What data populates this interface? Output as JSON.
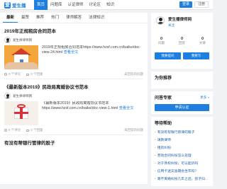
{
  "brand": {
    "name": "爱生播",
    "accent": "#1e7fe0"
  },
  "nav": [
    "首页",
    "问题库",
    "认证律师",
    "讨论区",
    "知识"
  ],
  "top_buttons": {
    "login": "登录",
    "register": "注册"
  },
  "tabs": [
    "最新",
    "最赞",
    "推荐",
    "热门",
    "律师解答",
    "法律知识"
  ],
  "cards": [
    {
      "title": "2019年正规租房合同范本",
      "author": "爱生律律师网",
      "excerpt": "2019年正规租房合同范本https://www.hzsf.com.cn/baike/doc-view-24.html",
      "more": "查看全文",
      "likes": "0 个评论",
      "comments": "0 个回复",
      "time": "未回答的问题",
      "thumb": "house"
    },
    {
      "title": "《最新版本2019》民政局离婚协议书范本",
      "author": "爱生律律师网",
      "excerpt": "《最新版本2019》民政局离婚协议书范本https://www.hzsf.com.cn/baike/doc-view-1.html",
      "more": "查看全文",
      "likes": "0 个评论",
      "comments": "0 个回复",
      "time": "未回答的问题",
      "thumb": "ribbon"
    },
    {
      "title": "有没有帮银行管律的股子",
      "author": "",
      "excerpt": "",
      "more": "",
      "likes": "",
      "comments": "",
      "time": "",
      "thumb": ""
    }
  ],
  "profile": {
    "name": "爱生播律师网",
    "follow": "关注",
    "stats": [
      {
        "value": "0",
        "label": "问题"
      },
      {
        "value": "0",
        "label": "回答"
      },
      {
        "value": "0",
        "label": "文章"
      }
    ],
    "btn_ask": "我要提问",
    "btn_write": "我要写"
  },
  "side_sections": {
    "recommend": "为你推荐",
    "experts": "问答专家",
    "experts_more": "更多 »",
    "apply": "申请认证",
    "help": "等待帮助"
  },
  "help_items": [
    "有没有帮银行管律的股子",
    "请教律师",
    "租房纠纷",
    "劳动合同纠纷怎么处理",
    "对于债权纠纷，可以起诉吗",
    "信用卡透支逾期会坐牢吗？",
    "离不离婚纠纷几年之后，孩子归谁？"
  ]
}
